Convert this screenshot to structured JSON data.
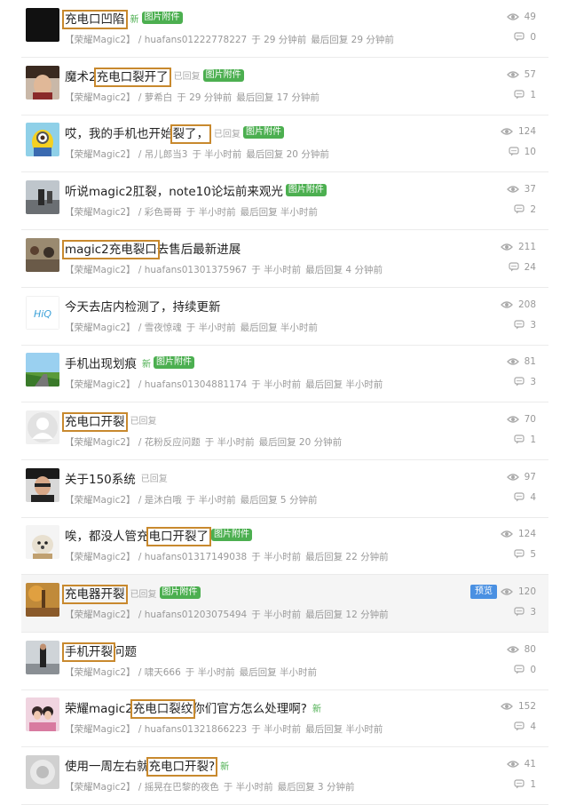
{
  "threads": [
    {
      "title_parts": [
        {
          "t": "充电口凹陷",
          "hl": true
        }
      ],
      "tags": [
        "new",
        "img"
      ],
      "forum": "【荣耀Magic2】",
      "author": "huafans01222778227",
      "time": "于 29 分钟前",
      "last_reply": "最后回复 29 分钟前",
      "views": "49",
      "replies": "0",
      "avatar": "black"
    },
    {
      "title_parts": [
        {
          "t": "魔术2"
        },
        {
          "t": "充电口裂开了",
          "hl": true
        }
      ],
      "tags": [
        "replied",
        "img"
      ],
      "forum": "【荣耀Magic2】",
      "author": "萝希白",
      "time": "于 29 分钟前",
      "last_reply": "最后回复 17 分钟前",
      "views": "57",
      "replies": "1",
      "avatar": "face"
    },
    {
      "title_parts": [
        {
          "t": "哎，我的手机也开始"
        },
        {
          "t": "裂了，",
          "hl": true
        }
      ],
      "tags": [
        "replied",
        "img"
      ],
      "forum": "【荣耀Magic2】",
      "author": "吊儿郎当3",
      "time": "于 半小时前",
      "last_reply": "最后回复 20 分钟前",
      "views": "124",
      "replies": "10",
      "avatar": "minion"
    },
    {
      "title_parts": [
        {
          "t": "听说magic2肛裂，note10论坛前来观光"
        }
      ],
      "tags": [
        "img"
      ],
      "forum": "【荣耀Magic2】",
      "author": "彩色哥哥",
      "time": "于 半小时前",
      "last_reply": "最后回复 半小时前",
      "views": "37",
      "replies": "2",
      "avatar": "street"
    },
    {
      "title_parts": [
        {
          "t": "magic2充电裂口",
          "hl": true
        },
        {
          "t": "去售后最新进展"
        }
      ],
      "tags": [],
      "forum": "【荣耀Magic2】",
      "author": "huafans01301375967",
      "time": "于 半小时前",
      "last_reply": "最后回复 4 分钟前",
      "views": "211",
      "replies": "24",
      "avatar": "crowd"
    },
    {
      "title_parts": [
        {
          "t": "今天去店内检测了，持续更新"
        }
      ],
      "tags": [],
      "forum": "【荣耀Magic2】",
      "author": "雪夜惊魂",
      "time": "于 半小时前",
      "last_reply": "最后回复 半小时前",
      "views": "208",
      "replies": "3",
      "avatar": "logo"
    },
    {
      "title_parts": [
        {
          "t": "手机出现划痕"
        }
      ],
      "tags": [
        "new",
        "img"
      ],
      "forum": "【荣耀Magic2】",
      "author": "huafans01304881174",
      "time": "于 半小时前",
      "last_reply": "最后回复 半小时前",
      "views": "81",
      "replies": "3",
      "avatar": "landscape"
    },
    {
      "title_parts": [
        {
          "t": "充电口开裂",
          "hl": true
        }
      ],
      "tags": [
        "replied"
      ],
      "forum": "【荣耀Magic2】",
      "author": "花粉反应问题",
      "time": "于 半小时前",
      "last_reply": "最后回复 20 分钟前",
      "views": "70",
      "replies": "1",
      "avatar": "default"
    },
    {
      "title_parts": [
        {
          "t": "关于150系统"
        }
      ],
      "tags": [
        "replied"
      ],
      "forum": "【荣耀Magic2】",
      "author": "是沐白哦",
      "time": "于 半小时前",
      "last_reply": "最后回复 5 分钟前",
      "views": "97",
      "replies": "4",
      "avatar": "man"
    },
    {
      "title_parts": [
        {
          "t": "唉，都没人管充"
        },
        {
          "t": "电口开裂了",
          "hl": true
        }
      ],
      "tags": [
        "img"
      ],
      "forum": "【荣耀Magic2】",
      "author": "huafans01317149038",
      "time": "于 半小时前",
      "last_reply": "最后回复 22 分钟前",
      "views": "124",
      "replies": "5",
      "avatar": "dog"
    },
    {
      "title_parts": [
        {
          "t": "充电器开裂",
          "hl": true
        }
      ],
      "tags": [
        "replied",
        "img"
      ],
      "forum": "【荣耀Magic2】",
      "author": "huafans01203075494",
      "time": "于 半小时前",
      "last_reply": "最后回复 12 分钟前",
      "views": "120",
      "replies": "3",
      "avatar": "autumn",
      "preview": "预览",
      "highlight": true
    },
    {
      "title_parts": [
        {
          "t": "手机开裂",
          "hl": true
        },
        {
          "t": "问题"
        }
      ],
      "tags": [],
      "forum": "【荣耀Magic2】",
      "author": "啸天666",
      "time": "于 半小时前",
      "last_reply": "最后回复 半小时前",
      "views": "80",
      "replies": "0",
      "avatar": "standing"
    },
    {
      "title_parts": [
        {
          "t": "荣耀magic2"
        },
        {
          "t": "充电口裂纹",
          "hl": true
        },
        {
          "t": "你们官方怎么处理啊?"
        }
      ],
      "tags": [
        "new"
      ],
      "forum": "【荣耀Magic2】",
      "author": "huafans01321866223",
      "time": "于 半小时前",
      "last_reply": "最后回复 半小时前",
      "views": "152",
      "replies": "4",
      "avatar": "couple"
    },
    {
      "title_parts": [
        {
          "t": "使用一周左右就"
        },
        {
          "t": "充电口开裂?",
          "hl": true
        }
      ],
      "tags": [
        "new"
      ],
      "forum": "【荣耀Magic2】",
      "author": "摇晃在巴黎的夜色",
      "time": "于 半小时前",
      "last_reply": "最后回复 3 分钟前",
      "views": "41",
      "replies": "1",
      "avatar": "blur"
    }
  ],
  "labels": {
    "new": "新",
    "replied": "已回复",
    "img": "图片附件",
    "sep": " / "
  },
  "colors": {
    "accent_green": "#4caf50",
    "highlight_box": "#c8892e",
    "preview_blue": "#4a90e2"
  }
}
